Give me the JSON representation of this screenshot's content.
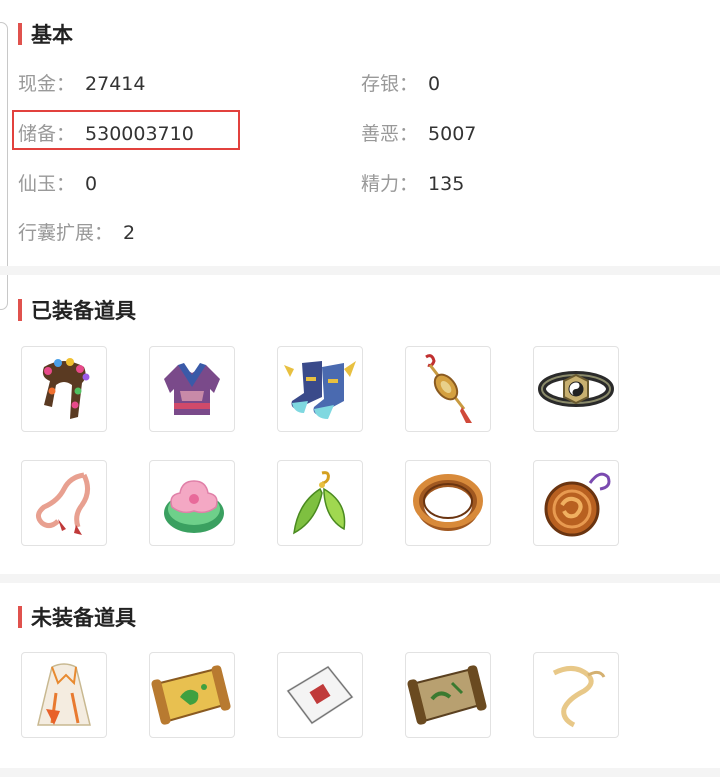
{
  "basic": {
    "title": "基本",
    "fields": [
      {
        "key": "现金：",
        "value": "27414"
      },
      {
        "key": "存银：",
        "value": "0"
      },
      {
        "key": "储备：",
        "value": "530003710"
      },
      {
        "key": "善恶：",
        "value": "5007"
      },
      {
        "key": "仙玉：",
        "value": "0"
      },
      {
        "key": "精力：",
        "value": "135"
      },
      {
        "key": "行囊扩展：",
        "value": "2"
      }
    ]
  },
  "equipped": {
    "title": "已装备道具",
    "items": [
      "flower-scarf-icon",
      "purple-armor-icon",
      "winged-boots-icon",
      "jade-pendant-icon",
      "bagua-belt-icon",
      "pink-ribbon-icon",
      "lotus-jade-icon",
      "leaf-earring-icon",
      "bronze-ring-icon",
      "dragon-medallion-icon"
    ]
  },
  "unequipped": {
    "title": "未装备道具",
    "items": [
      "white-robe-icon",
      "treasure-map-icon",
      "sealed-envelope-icon",
      "old-map-icon",
      "golden-ribbon-icon"
    ]
  },
  "colors": {
    "accent": "#e0524d",
    "highlight": "#e2413d"
  }
}
